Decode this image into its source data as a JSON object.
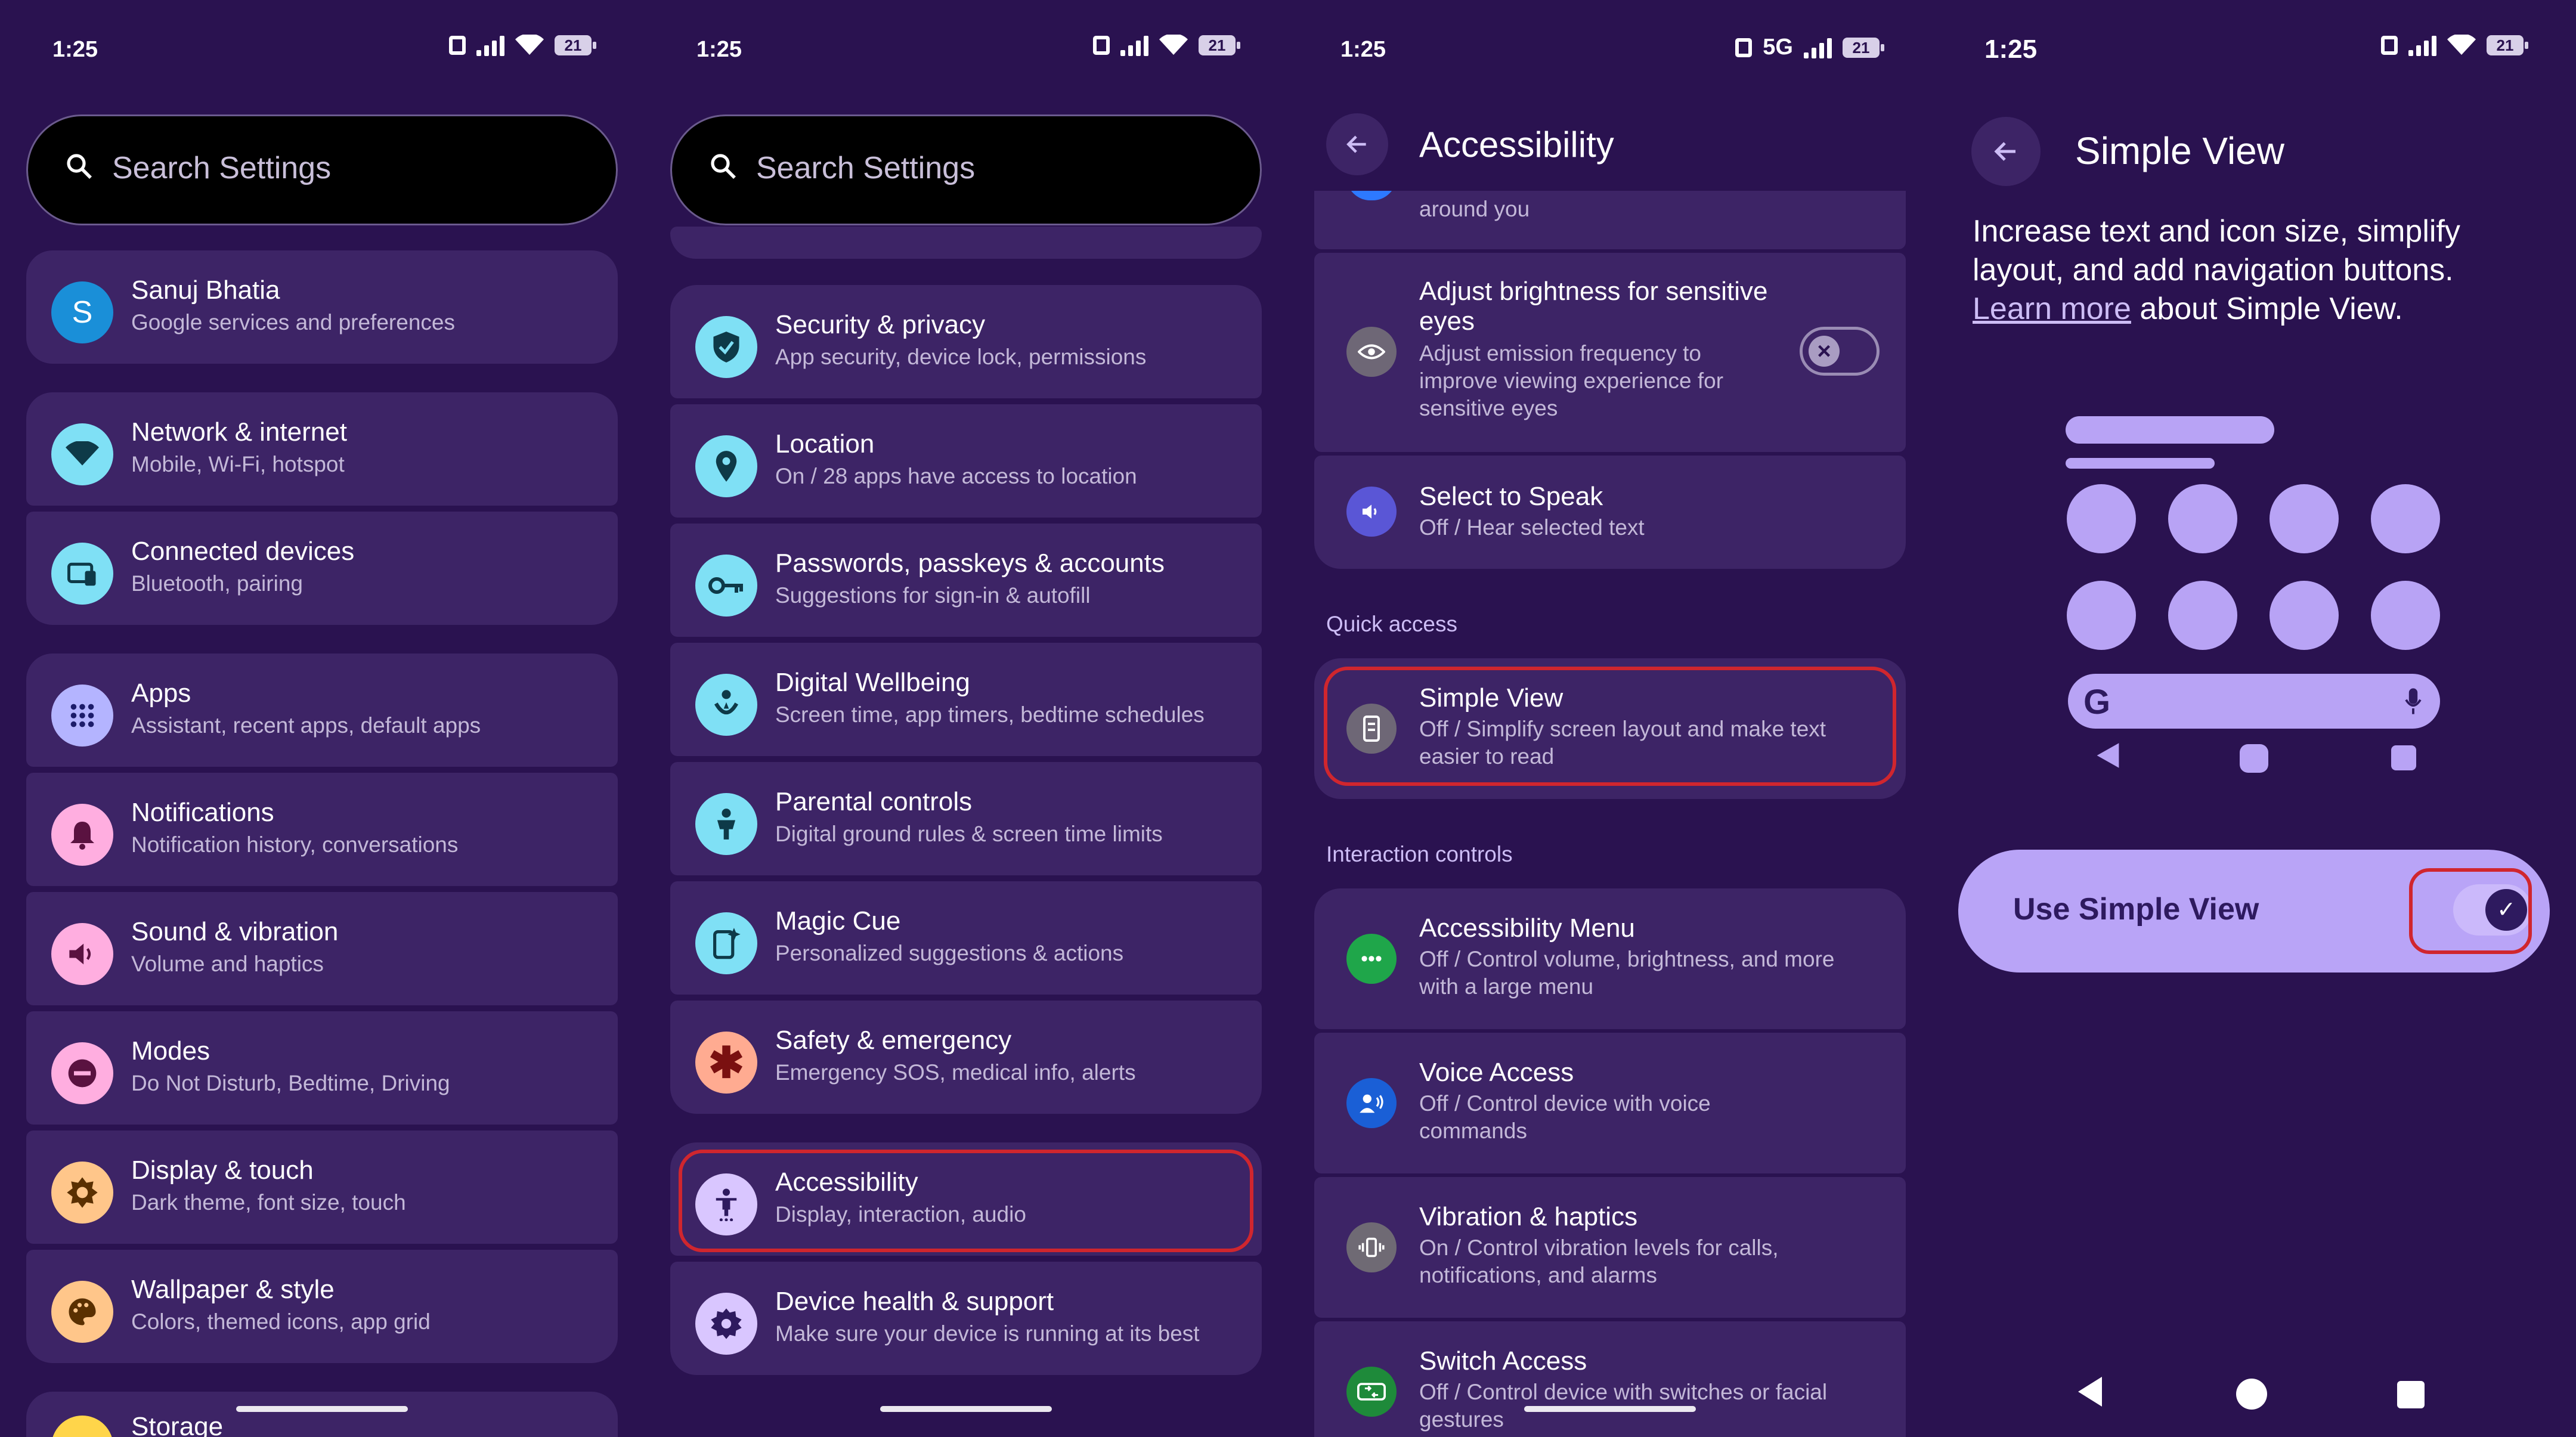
{
  "status": {
    "time": "1:25",
    "battery": "21",
    "network_5g": "5G"
  },
  "screen1": {
    "search_placeholder": "Search Settings",
    "items": [
      {
        "title": "Sanuj Bhatia",
        "subtitle": "Google services and preferences",
        "icon": "avatar-letter",
        "icon_text": "S",
        "color": "#1a8fd8"
      },
      {
        "title": "Network & internet",
        "subtitle": "Mobile, Wi-Fi, hotspot",
        "icon": "wifi-icon",
        "color": "#7fe0f5"
      },
      {
        "title": "Connected devices",
        "subtitle": "Bluetooth, pairing",
        "icon": "devices-icon",
        "color": "#7fe0f5"
      },
      {
        "title": "Apps",
        "subtitle": "Assistant, recent apps, default apps",
        "icon": "apps-grid-icon",
        "color": "#b4b4ff"
      },
      {
        "title": "Notifications",
        "subtitle": "Notification history, conversations",
        "icon": "bell-icon",
        "color": "#ffaee0"
      },
      {
        "title": "Sound & vibration",
        "subtitle": "Volume and haptics",
        "icon": "volume-icon",
        "color": "#ffaee0"
      },
      {
        "title": "Modes",
        "subtitle": "Do Not Disturb, Bedtime, Driving",
        "icon": "do-not-disturb-icon",
        "color": "#ffaee0"
      },
      {
        "title": "Display & touch",
        "subtitle": "Dark theme, font size, touch",
        "icon": "brightness-icon",
        "color": "#ffc68a"
      },
      {
        "title": "Wallpaper & style",
        "subtitle": "Colors, themed icons, app grid",
        "icon": "palette-icon",
        "color": "#ffc68a"
      },
      {
        "title": "Storage",
        "subtitle": "",
        "icon": "storage-icon",
        "color": "#ffd54a"
      }
    ]
  },
  "screen2": {
    "search_placeholder": "Search Settings",
    "items": [
      {
        "title": "Security & privacy",
        "subtitle": "App security, device lock, permissions",
        "icon": "shield-icon",
        "color": "#7fe0f5"
      },
      {
        "title": "Location",
        "subtitle": "On / 28 apps have access to location",
        "icon": "location-pin-icon",
        "color": "#7fe0f5"
      },
      {
        "title": "Passwords, passkeys & accounts",
        "subtitle": "Suggestions for sign-in & autofill",
        "icon": "key-icon",
        "color": "#7fe0f5"
      },
      {
        "title": "Digital Wellbeing",
        "subtitle": "Screen time, app timers, bedtime schedules",
        "icon": "wellbeing-icon",
        "color": "#7fe0f5"
      },
      {
        "title": "Parental controls",
        "subtitle": "Digital ground rules & screen time limits",
        "icon": "parental-icon",
        "color": "#7fe0f5"
      },
      {
        "title": "Magic Cue",
        "subtitle": "Personalized suggestions & actions",
        "icon": "magic-cue-icon",
        "color": "#7fe0f5"
      },
      {
        "title": "Safety & emergency",
        "subtitle": "Emergency SOS, medical info, alerts",
        "icon": "asterisk-icon",
        "color": "#ffab91"
      },
      {
        "title": "Accessibility",
        "subtitle": "Display, interaction, audio",
        "icon": "accessibility-icon",
        "color": "#d9c6ff"
      },
      {
        "title": "Device health & support",
        "subtitle": "Make sure your device is running at its best",
        "icon": "gear-icon",
        "color": "#d9c6ff"
      }
    ]
  },
  "screen3": {
    "title": "Accessibility",
    "partial_text": "around you",
    "items": [
      {
        "title": "Adjust brightness for sensitive eyes",
        "subtitle": "Adjust emission frequency to improve viewing experience for sensitive eyes",
        "icon": "eye-icon"
      },
      {
        "title": "Select to Speak",
        "subtitle": "Off / Hear selected text",
        "icon": "speak-icon"
      }
    ],
    "section_quick": "Quick access",
    "simple_view": {
      "title": "Simple View",
      "subtitle": "Off / Simplify screen layout and make text easier to read",
      "icon": "simple-view-icon"
    },
    "section_interaction": "Interaction controls",
    "interaction": [
      {
        "title": "Accessibility Menu",
        "subtitle": "Off / Control volume, brightness, and more with a large menu",
        "icon": "menu-dots-icon",
        "color": "#1fa64a"
      },
      {
        "title": "Voice Access",
        "subtitle": "Off / Control device with voice commands",
        "icon": "voice-access-icon",
        "color": "#1a5fd6"
      },
      {
        "title": "Vibration & haptics",
        "subtitle": "On / Control vibration levels for calls, notifications, and alarms",
        "icon": "vibration-icon",
        "color": "#6f6a74"
      },
      {
        "title": "Switch Access",
        "subtitle": "Off / Control device with switches or facial gestures",
        "icon": "switch-access-icon",
        "color": "#1e8a3a"
      }
    ]
  },
  "screen4": {
    "title": "Simple View",
    "desc_before": "Increase text and icon size, simplify layout, and add navigation buttons. ",
    "learn_more": "Learn more",
    "desc_after": " about Simple View.",
    "use_label": "Use Simple View",
    "toggle_on": true
  }
}
